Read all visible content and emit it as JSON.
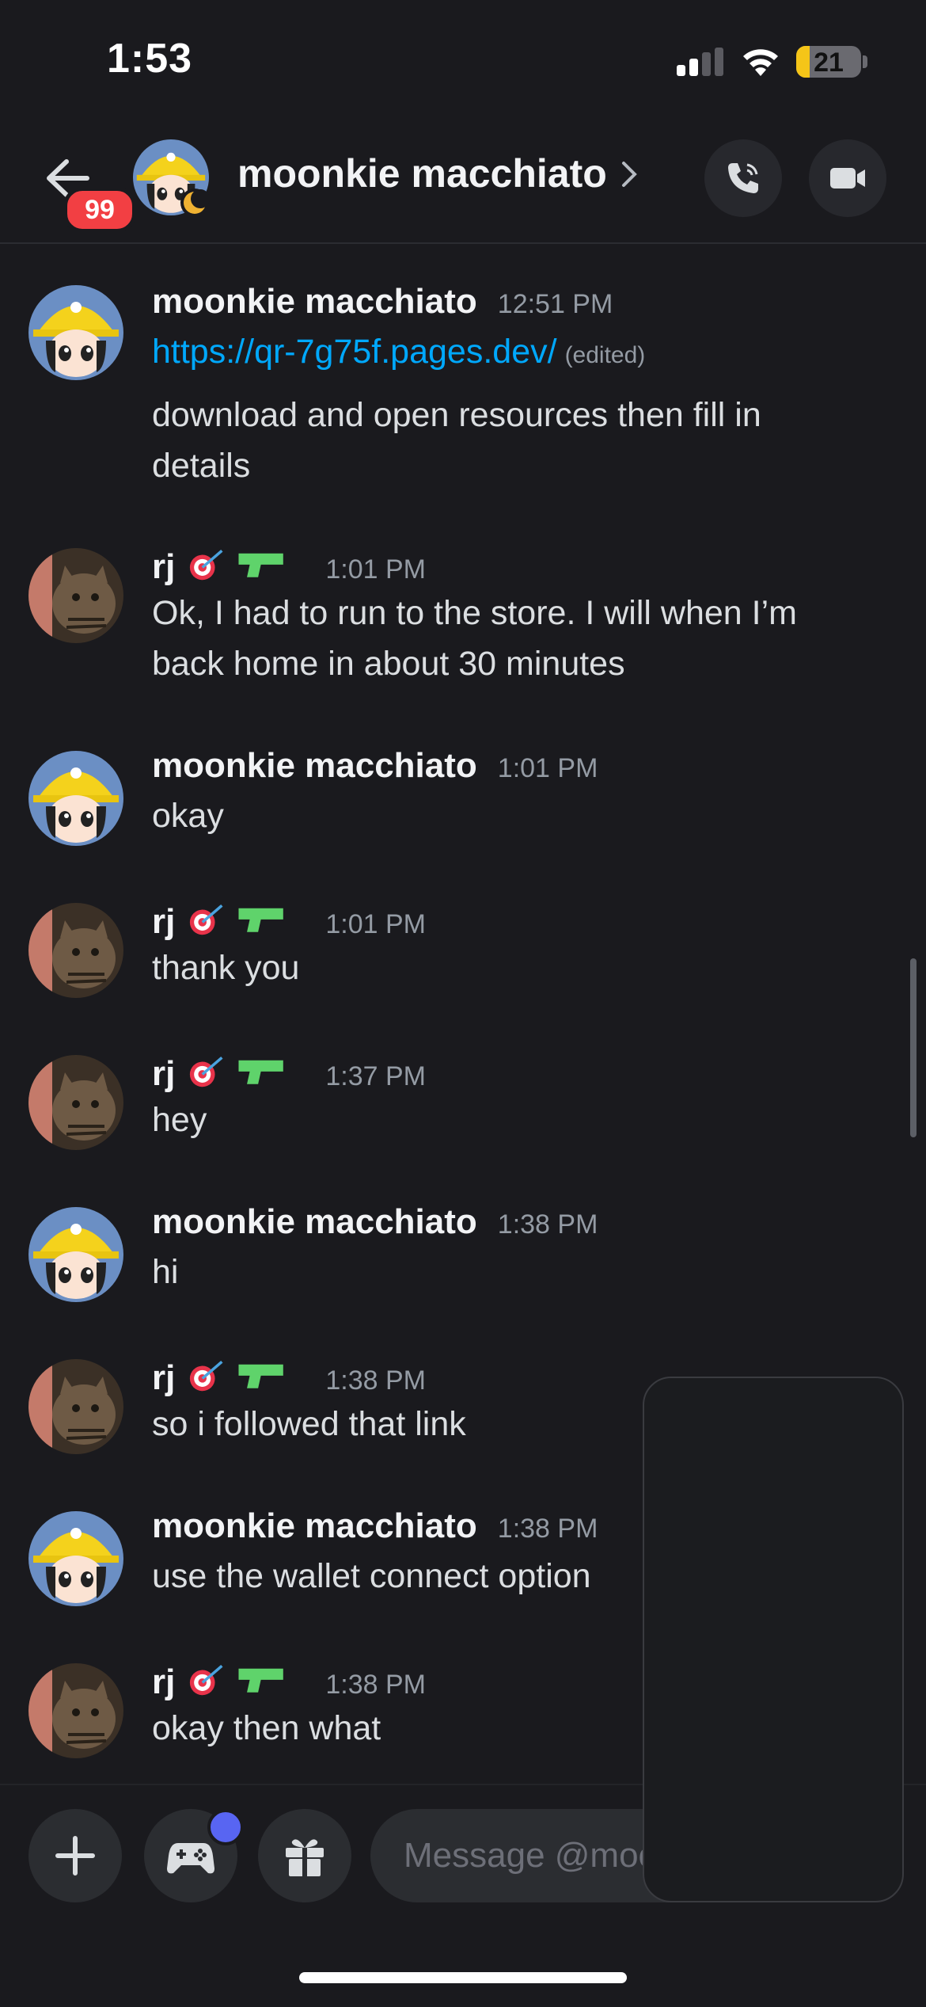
{
  "status_bar": {
    "time": "1:53",
    "battery": "21",
    "battery_level": 0.21
  },
  "header": {
    "title": "moonkie macchiato",
    "unread_badge": "99"
  },
  "messages": [
    {
      "author": "moonkie macchiato",
      "time": "12:51 PM",
      "link": "https://qr-7g75f.pages.dev/",
      "edited": "(edited)",
      "text": "download and open resources then fill in details",
      "avatar": "hardhat-girl"
    },
    {
      "author": "rj",
      "time": "1:01 PM",
      "text": "Ok, I had to run to the store. I will when I’m back home in about 30 minutes",
      "avatar": "cat"
    },
    {
      "author": "moonkie macchiato",
      "time": "1:01 PM",
      "text": "okay",
      "avatar": "hardhat-girl"
    },
    {
      "author": "rj",
      "time": "1:01 PM",
      "text": "thank you",
      "avatar": "cat"
    },
    {
      "author": "rj",
      "time": "1:37 PM",
      "text": "hey",
      "avatar": "cat"
    },
    {
      "author": "moonkie macchiato",
      "time": "1:38 PM",
      "text": "hi",
      "avatar": "hardhat-girl"
    },
    {
      "author": "rj",
      "time": "1:38 PM",
      "text": "so i followed that link",
      "avatar": "cat"
    },
    {
      "author": "moonkie macchiato",
      "time": "1:38 PM",
      "text": "use the wallet connect option",
      "avatar": "hardhat-girl"
    },
    {
      "author": "rj",
      "time": "1:38 PM",
      "text": "okay then what",
      "avatar": "cat"
    }
  ],
  "composer": {
    "placeholder": "Message @moonkie macchiato"
  },
  "icons": {
    "back": "arrow-left-icon",
    "chevron": "chevron-right-icon",
    "call": "phone-icon",
    "video": "video-camera-icon",
    "add": "plus-icon",
    "games": "gamepad-icon",
    "gift": "gift-icon",
    "name_emojis": [
      "dart-icon",
      "water-pistol-icon"
    ]
  },
  "colors": {
    "background": "#1a1a1e",
    "link": "#00a8fc",
    "badge": "#f23f43",
    "accent": "#5865f2",
    "timestamp": "#949ba4"
  }
}
